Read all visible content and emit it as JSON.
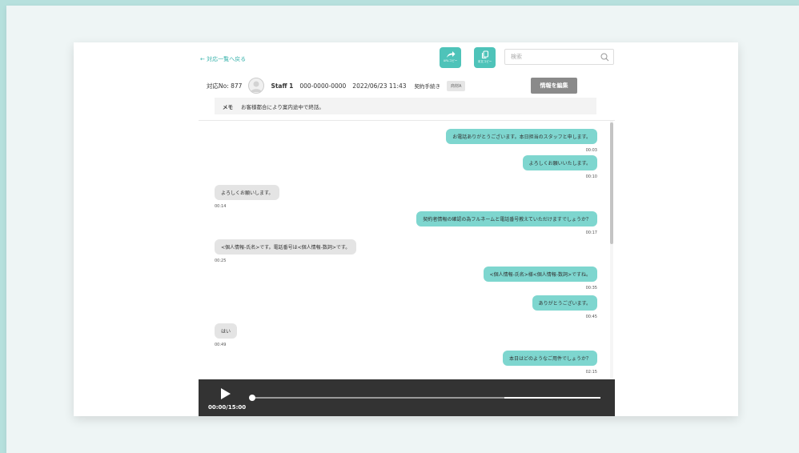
{
  "nav": {
    "back_label": "← 対応一覧へ戻る"
  },
  "toolbar": {
    "url_copy_label": "URLコピー",
    "text_copy_label": "本文コピー",
    "accent_color": "#4ec3b9"
  },
  "search": {
    "placeholder": "検索"
  },
  "record": {
    "case_no": "対応No: 877",
    "staff": "Staff 1",
    "phone": "000-0000-0000",
    "datetime": "2022/06/23 11:43",
    "category": "契約手続き",
    "tag": "商材A",
    "edit_label": "情報を編集"
  },
  "memo": {
    "label": "メモ",
    "text": "お客様都合により案内途中で終話。"
  },
  "messages": [
    {
      "speaker": "agent",
      "text": "お電話ありがとうございます。本日担当のスタッフと申します。",
      "time": "00:03"
    },
    {
      "speaker": "agent",
      "text": "よろしくお願いいたします。",
      "time": "00:10"
    },
    {
      "speaker": "customer",
      "text": "よろしくお願いします。",
      "time": "00:14"
    },
    {
      "speaker": "agent",
      "text": "契約者情報の確認の為フルネームと電話番号教えていただけますでしょうか？",
      "time": "00:17"
    },
    {
      "speaker": "customer",
      "text": "<個人情報-氏名>です。電話番号は<個人情報-数詞>です。",
      "time": "00:25"
    },
    {
      "speaker": "agent",
      "text": "<個人情報-氏名>様<個人情報-数詞>ですね。",
      "time": "00:35"
    },
    {
      "speaker": "agent",
      "text": "ありがとうございます。",
      "time": "00:45"
    },
    {
      "speaker": "customer",
      "text": "はい",
      "time": "00:49"
    },
    {
      "speaker": "agent",
      "text": "本日はどのようなご用件でしょうか？",
      "time": "02:15"
    }
  ],
  "player": {
    "time_display": "00:00/15:00",
    "progress_fraction": 0
  },
  "colors": {
    "agent_bubble": "#7ed6cf",
    "customer_bubble": "#e4e4e4",
    "player_bg": "#333333",
    "page_bg": "#b6e0dd"
  }
}
